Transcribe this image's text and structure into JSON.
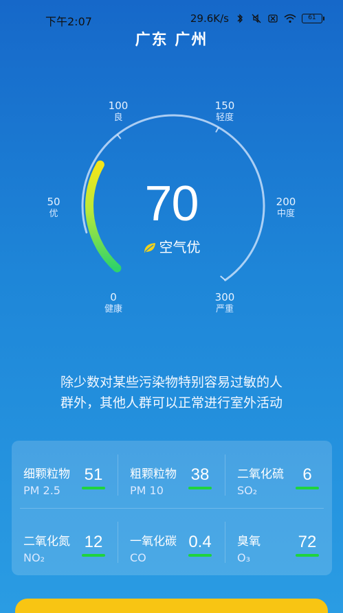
{
  "status": {
    "time": "下午2:07",
    "speed": "29.6K/s",
    "battery": "61"
  },
  "city": "广东 广州",
  "gauge": {
    "ticks": [
      {
        "value": "0",
        "level": "健康"
      },
      {
        "value": "50",
        "level": "优"
      },
      {
        "value": "100",
        "level": "良"
      },
      {
        "value": "150",
        "level": "轻度"
      },
      {
        "value": "200",
        "level": "中度"
      },
      {
        "value": "300",
        "level": "严重"
      }
    ],
    "aqi": "70",
    "quality": "空气优",
    "max": 300,
    "accent": "#27d36b"
  },
  "advice_line1": "除少数对某些污染物特别容易过敏的人",
  "advice_line2": "群外，其他人群可以正常进行室外活动",
  "pollutants": [
    {
      "name": "细颗粒物",
      "code": "PM 2.5",
      "value": "51"
    },
    {
      "name": "粗颗粒物",
      "code": "PM 10",
      "value": "38"
    },
    {
      "name": "二氧化硫",
      "code": "SO₂",
      "value": "6"
    },
    {
      "name": "二氧化氮",
      "code": "NO₂",
      "value": "12"
    },
    {
      "name": "一氧化碳",
      "code": "CO",
      "value": "0.4"
    },
    {
      "name": "臭氧",
      "code": "O₃",
      "value": "72"
    }
  ],
  "colors": {
    "bar_good": "#1fd43d",
    "button": "#f8c513"
  }
}
